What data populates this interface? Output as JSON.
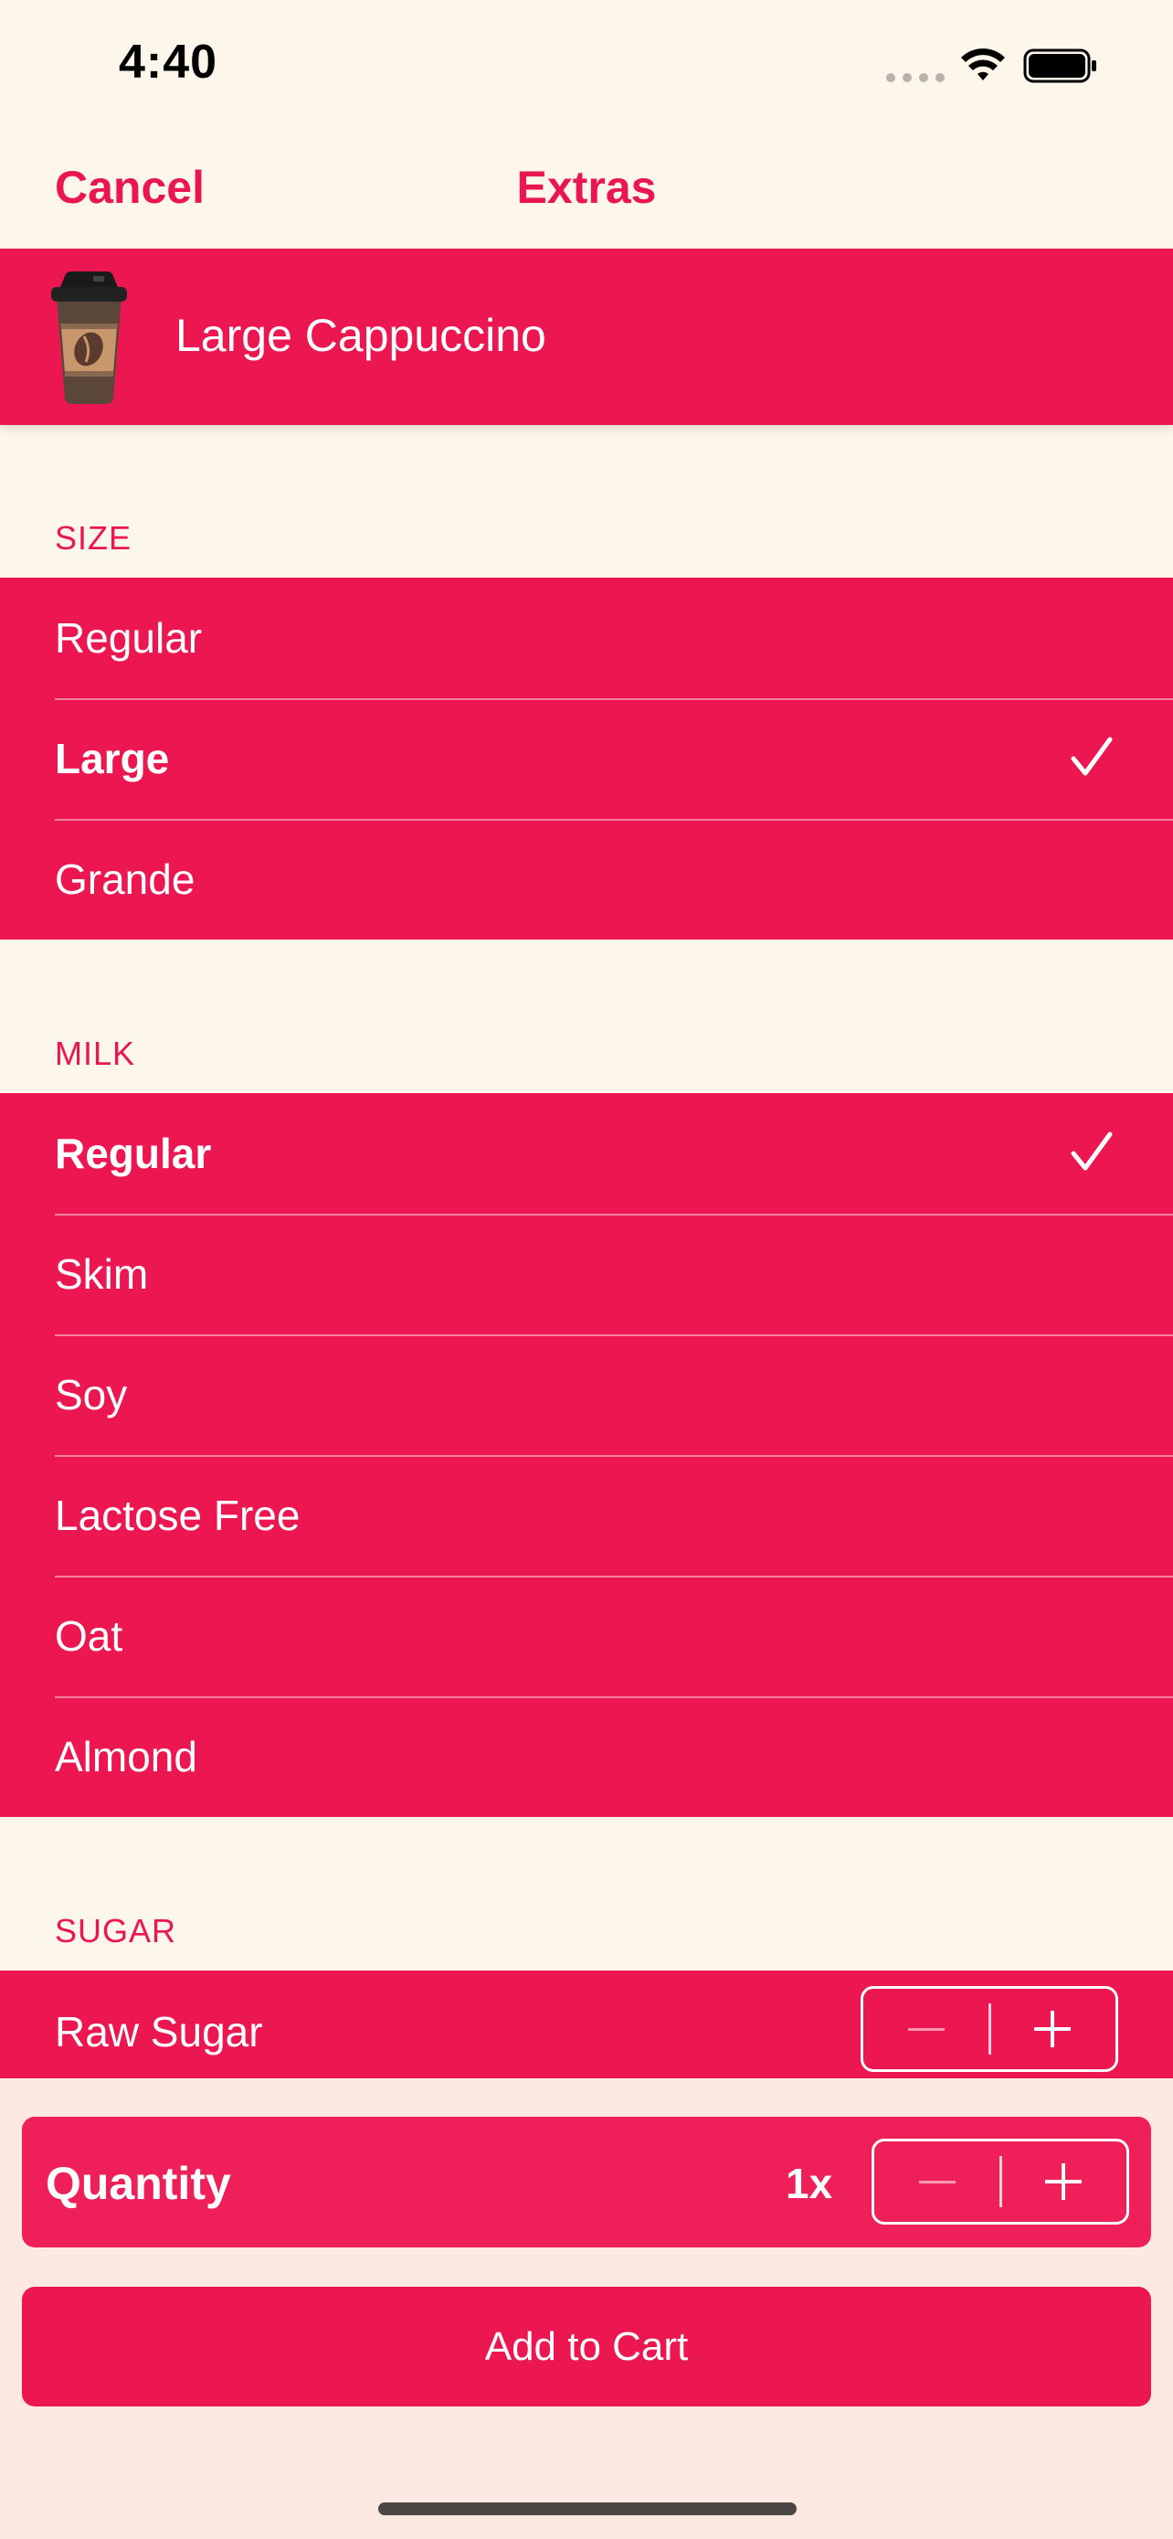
{
  "status_bar": {
    "time": "4:40"
  },
  "nav": {
    "cancel_label": "Cancel",
    "title": "Extras"
  },
  "product": {
    "name": "Large Cappuccino",
    "icon": "coffee-cup-icon"
  },
  "size_section": {
    "header": "SIZE",
    "options": [
      {
        "label": "Regular",
        "selected": false
      },
      {
        "label": "Large",
        "selected": true
      },
      {
        "label": "Grande",
        "selected": false
      }
    ]
  },
  "milk_section": {
    "header": "MILK",
    "options": [
      {
        "label": "Regular",
        "selected": true
      },
      {
        "label": "Skim",
        "selected": false
      },
      {
        "label": "Soy",
        "selected": false
      },
      {
        "label": "Lactose Free",
        "selected": false
      },
      {
        "label": "Oat",
        "selected": false
      },
      {
        "label": "Almond",
        "selected": false
      }
    ]
  },
  "sugar_section": {
    "header": "SUGAR",
    "items": [
      {
        "label": "Raw Sugar"
      }
    ]
  },
  "quantity": {
    "label": "Quantity",
    "value": "1x"
  },
  "add_to_cart_label": "Add to Cart",
  "colors": {
    "accent": "#ec1651",
    "background": "#fdf6ea",
    "bottom_background": "#fee8e2"
  }
}
